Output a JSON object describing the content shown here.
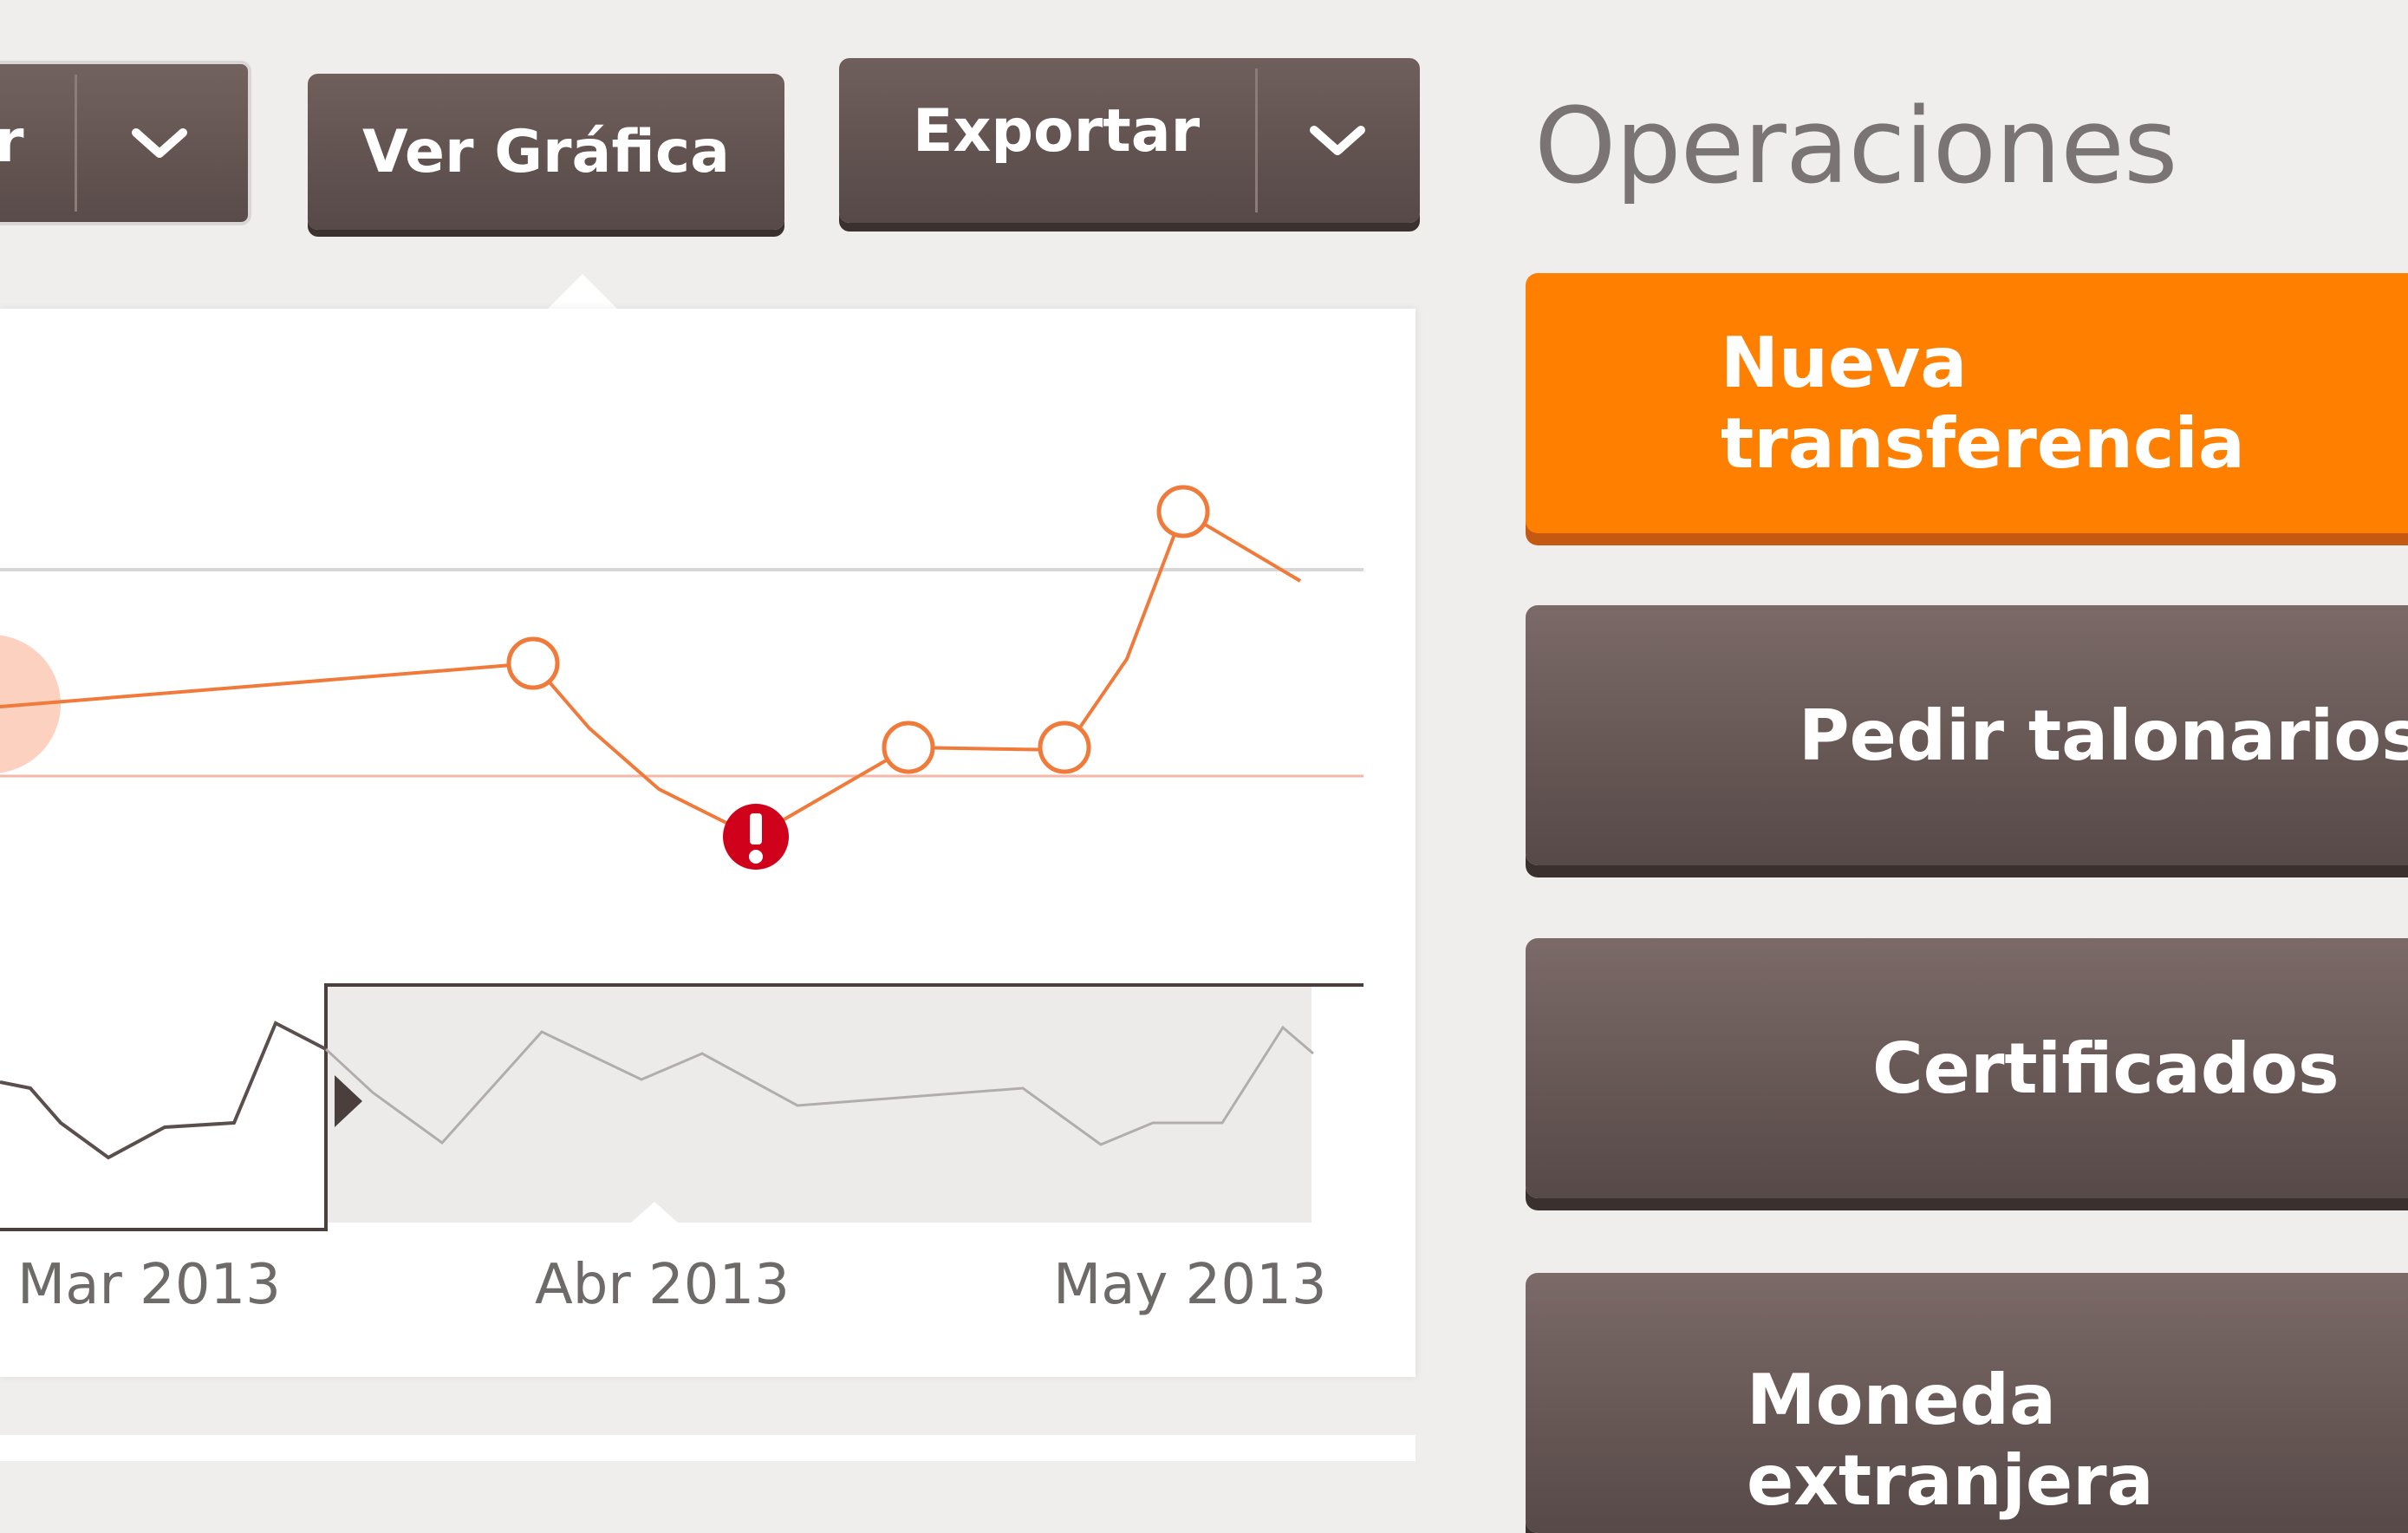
{
  "toolbar": {
    "left_partial_label": "r",
    "ver_grafica_label": "Ver Gráfica",
    "exportar_label": "Exportar"
  },
  "operations": {
    "title": "Operaciones",
    "buttons": [
      {
        "label": "Nueva transferencia"
      },
      {
        "label": "Pedir talonarios"
      },
      {
        "label": "Certificados"
      },
      {
        "label": "Moneda extranjera"
      }
    ]
  },
  "chart_data": {
    "type": "line",
    "x_ticks": [
      "Mar 2013",
      "Abr 2013",
      "May 2013"
    ],
    "title": "",
    "xlabel": "",
    "ylabel": ""
  },
  "colors": {
    "accent": "#ff7f00",
    "line": "#f07a3a",
    "alert": "#d0021b",
    "button": "#5e504d"
  }
}
